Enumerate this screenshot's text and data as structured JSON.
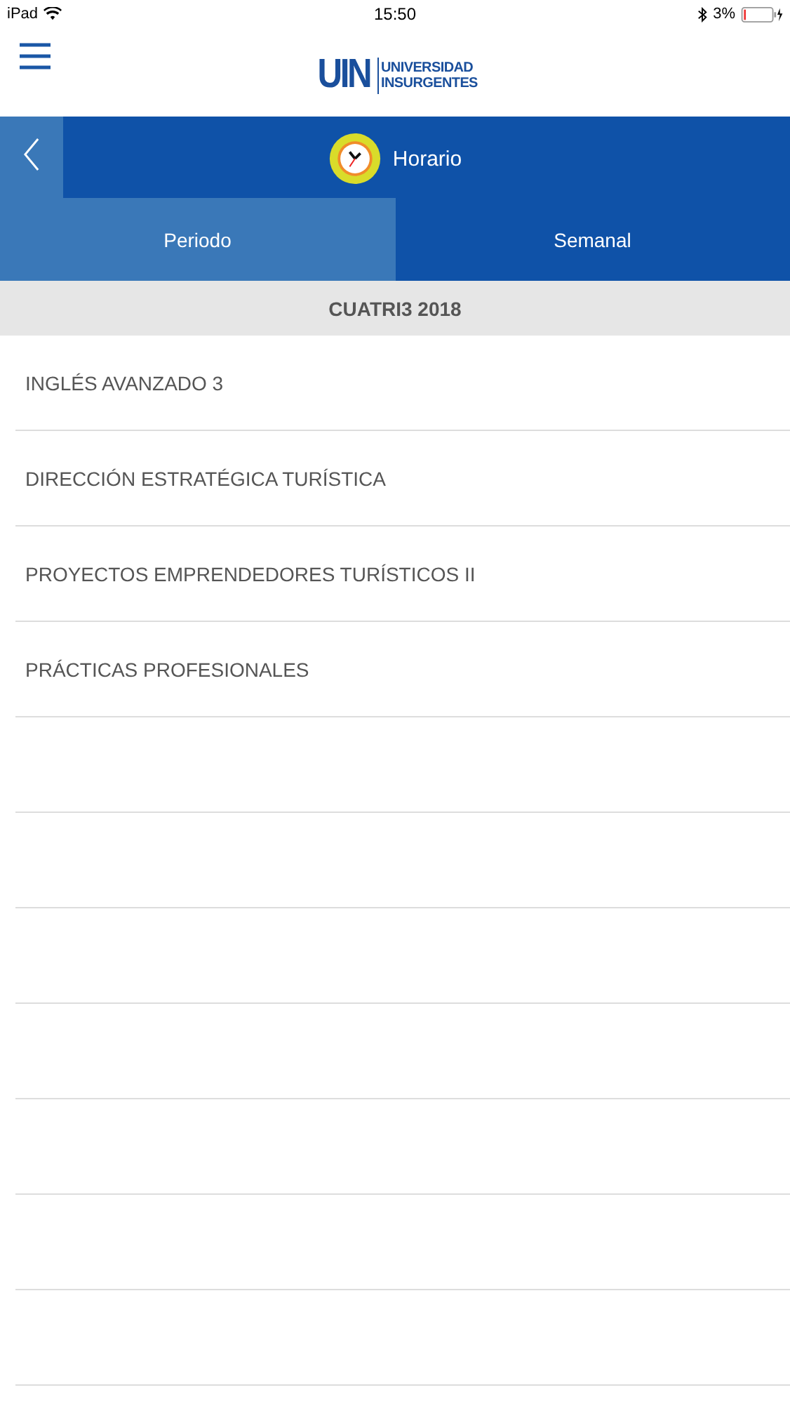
{
  "status_bar": {
    "device": "iPad",
    "time": "15:50",
    "battery": "3%"
  },
  "header": {
    "logo_mark": "UIN",
    "logo_lines": [
      "UNIVERSIDAD",
      "INSURGENTES"
    ]
  },
  "title_bar": {
    "title": "Horario"
  },
  "tabs": [
    {
      "label": "Periodo",
      "selected": true
    },
    {
      "label": "Semanal",
      "selected": false
    }
  ],
  "section": {
    "title": "CUATRI3 2018"
  },
  "courses": [
    {
      "name": "INGLÉS AVANZADO 3"
    },
    {
      "name": "DIRECCIÓN ESTRATÉGICA TURÍSTICA"
    },
    {
      "name": "PROYECTOS EMPRENDEDORES TURÍSTICOS II"
    },
    {
      "name": "PRÁCTICAS PROFESIONALES"
    }
  ]
}
